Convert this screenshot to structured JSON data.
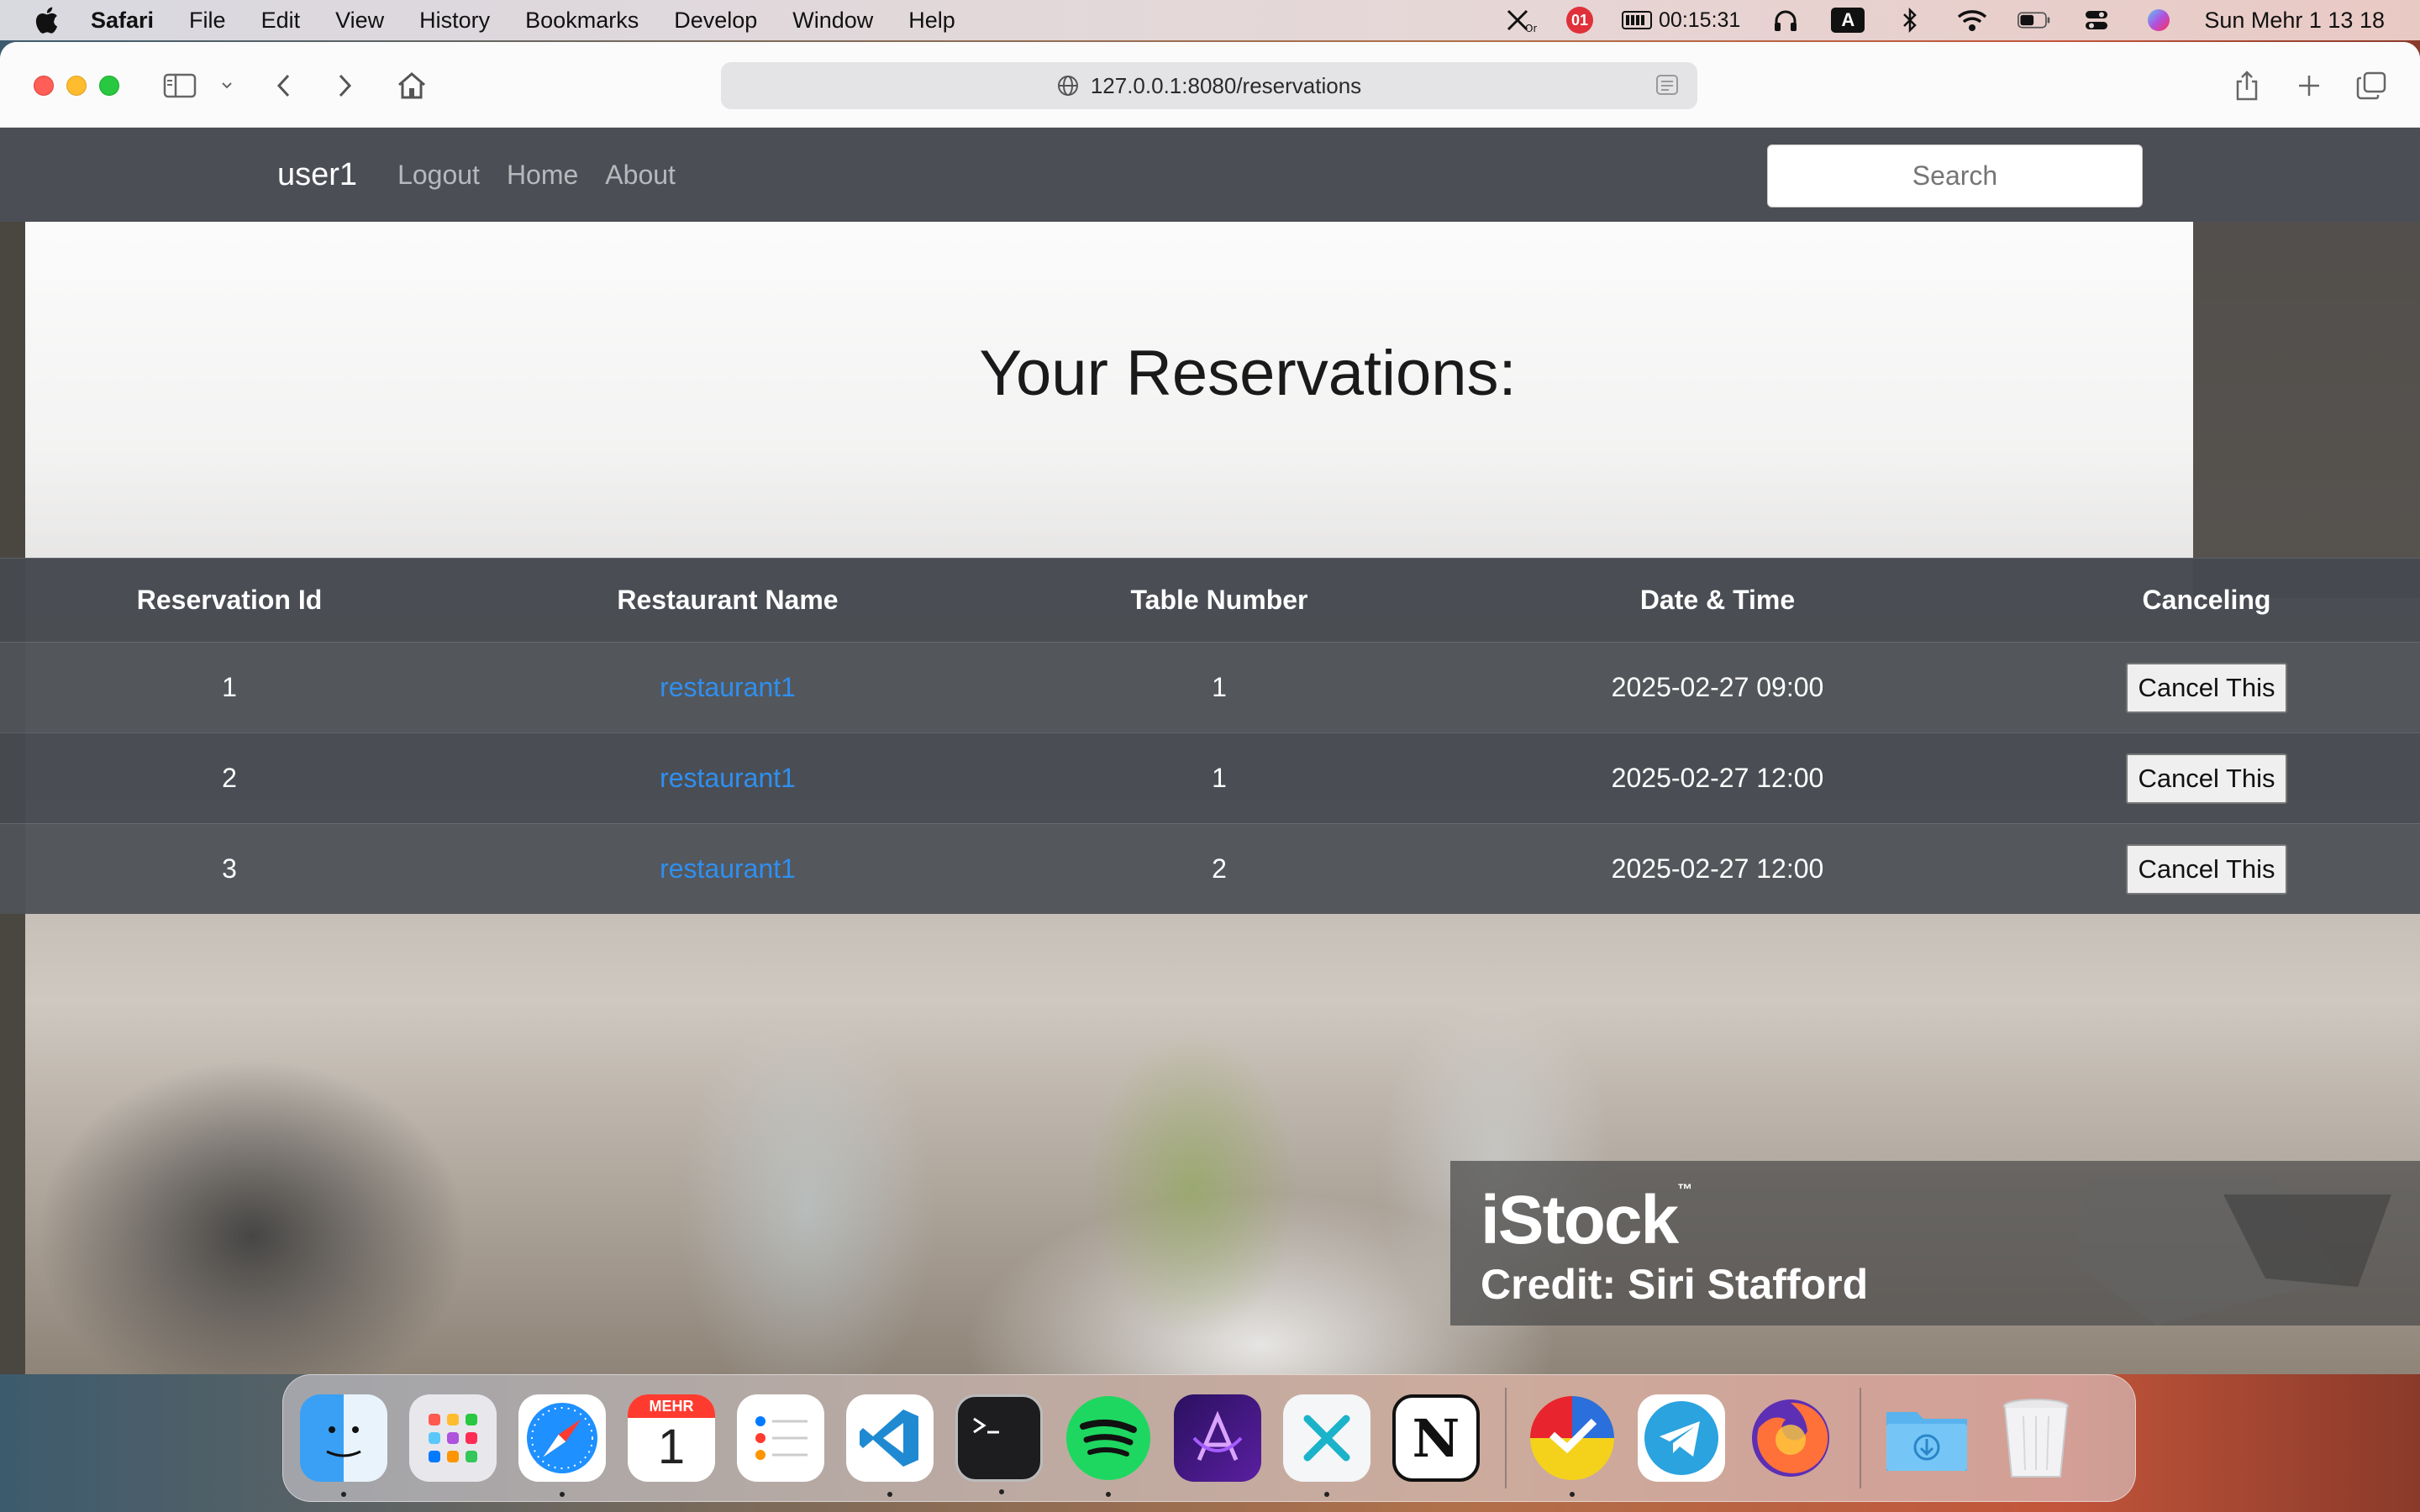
{
  "menubar": {
    "app_name": "Safari",
    "items": [
      "File",
      "Edit",
      "View",
      "History",
      "Bookmarks",
      "Develop",
      "Window",
      "Help"
    ],
    "status": {
      "badge_count": "01",
      "timer": "00:15:31",
      "keyboard_letter": "A",
      "clock": "Sun Mehr 1  13 18"
    }
  },
  "browser": {
    "url": "127.0.0.1:8080/reservations"
  },
  "navbar": {
    "brand": "user1",
    "links": [
      "Logout",
      "Home",
      "About"
    ],
    "search_placeholder": "Search"
  },
  "page": {
    "title": "Your Reservations:"
  },
  "table": {
    "headers": [
      "Reservation Id",
      "Restaurant Name",
      "Table Number",
      "Date & Time",
      "Canceling"
    ],
    "rows": [
      {
        "id": "1",
        "restaurant": "restaurant1",
        "table": "1",
        "datetime": "2025-02-27 09:00",
        "action": "Cancel This"
      },
      {
        "id": "2",
        "restaurant": "restaurant1",
        "table": "1",
        "datetime": "2025-02-27 12:00",
        "action": "Cancel This"
      },
      {
        "id": "3",
        "restaurant": "restaurant1",
        "table": "2",
        "datetime": "2025-02-27 12:00",
        "action": "Cancel This"
      }
    ]
  },
  "watermark": {
    "logo": "iStock",
    "credit": "Credit: Siri Stafford"
  },
  "dock": {
    "calendar_month": "MEHR",
    "calendar_day": "1",
    "apps": [
      "finder-icon",
      "launchpad-icon",
      "safari-icon",
      "calendar-icon",
      "reminders-icon",
      "vscode-icon",
      "terminal-icon",
      "spotify-icon",
      "affinity-icon",
      "xcode-cross-icon",
      "notion-icon",
      "todo-icon",
      "telegram-icon",
      "firefox-icon",
      "downloads-folder-icon",
      "trash-icon"
    ]
  },
  "colors": {
    "navbar": "#4b4e55",
    "link": "#2f8ff0",
    "table_bg": "#464a50"
  }
}
